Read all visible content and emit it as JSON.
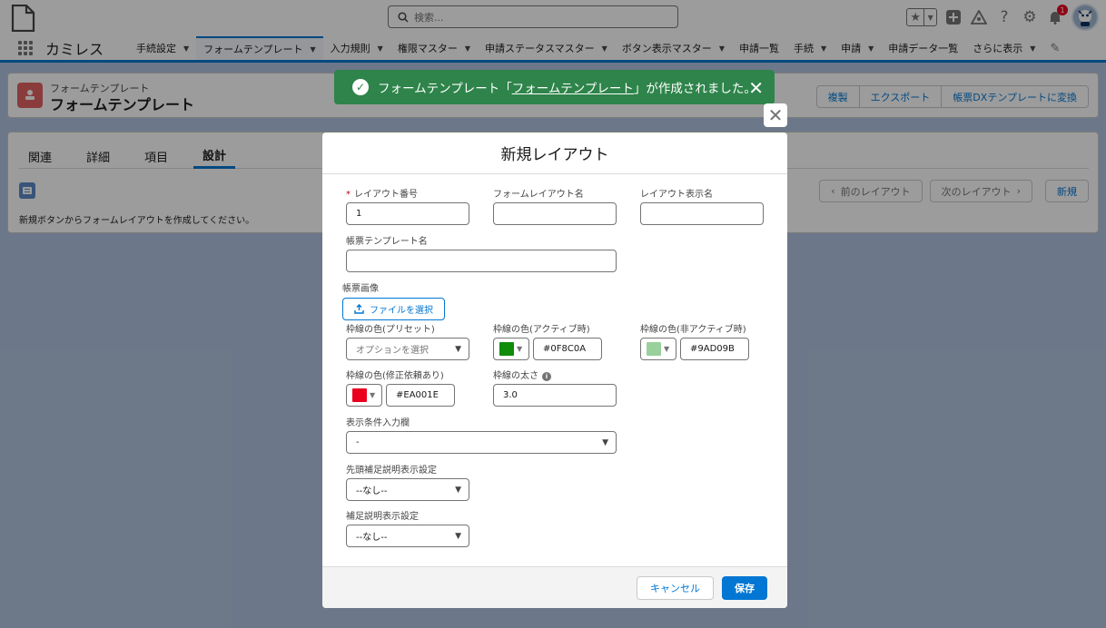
{
  "header": {
    "search_placeholder": "検索...",
    "notification_count": "1"
  },
  "nav": {
    "app_name": "カミレス",
    "items": [
      {
        "label": "手続設定"
      },
      {
        "label": "フォームテンプレート"
      },
      {
        "label": "入力規則"
      },
      {
        "label": "権限マスター"
      },
      {
        "label": "申請ステータスマスター"
      },
      {
        "label": "ボタン表示マスター"
      },
      {
        "label": "申請一覧"
      },
      {
        "label": "手続"
      },
      {
        "label": "申請"
      },
      {
        "label": "申請データ一覧"
      },
      {
        "label": "さらに表示"
      }
    ]
  },
  "page_header": {
    "object_label": "フォームテンプレート",
    "title": "フォームテンプレート",
    "buttons": [
      "複製",
      "エクスポート",
      "帳票DXテンプレートに変換"
    ]
  },
  "tabs": [
    "関連",
    "詳細",
    "項目",
    "設計"
  ],
  "design_panel": {
    "note": "新規ボタンからフォームレイアウトを作成してください。",
    "prev_label": "前のレイアウト",
    "next_label": "次のレイアウト",
    "new_label": "新規"
  },
  "toast": {
    "prefix": "フォームテンプレート「",
    "link": "フォームテンプレート",
    "suffix": "」が作成されました。"
  },
  "modal": {
    "title": "新規レイアウト",
    "fields": {
      "layout_number": {
        "label": "レイアウト番号",
        "value": "1"
      },
      "form_layout_name": {
        "label": "フォームレイアウト名",
        "value": ""
      },
      "layout_display_name": {
        "label": "レイアウト表示名",
        "value": ""
      },
      "template_name": {
        "label": "帳票テンプレート名",
        "value": ""
      },
      "image": {
        "label": "帳票画像",
        "button": "ファイルを選択"
      },
      "border_preset": {
        "label": "枠線の色(プリセット)",
        "placeholder": "オプションを選択"
      },
      "border_active": {
        "label": "枠線の色(アクティブ時)",
        "value": "#0F8C0A",
        "color": "#0F8C0A"
      },
      "border_inactive": {
        "label": "枠線の色(非アクティブ時)",
        "value": "#9AD09B",
        "color": "#9AD09B"
      },
      "border_revision": {
        "label": "枠線の色(修正依頼あり)",
        "value": "#EA001E",
        "color": "#EA001E"
      },
      "border_width": {
        "label": "枠線の太さ",
        "value": "3.0"
      },
      "display_condition": {
        "label": "表示条件入力欄",
        "value": "-"
      },
      "leading_help": {
        "label": "先頭補足説明表示設定",
        "value": "--なし--"
      },
      "help": {
        "label": "補足説明表示設定",
        "value": "--なし--"
      }
    },
    "cancel_label": "キャンセル",
    "save_label": "保存"
  }
}
